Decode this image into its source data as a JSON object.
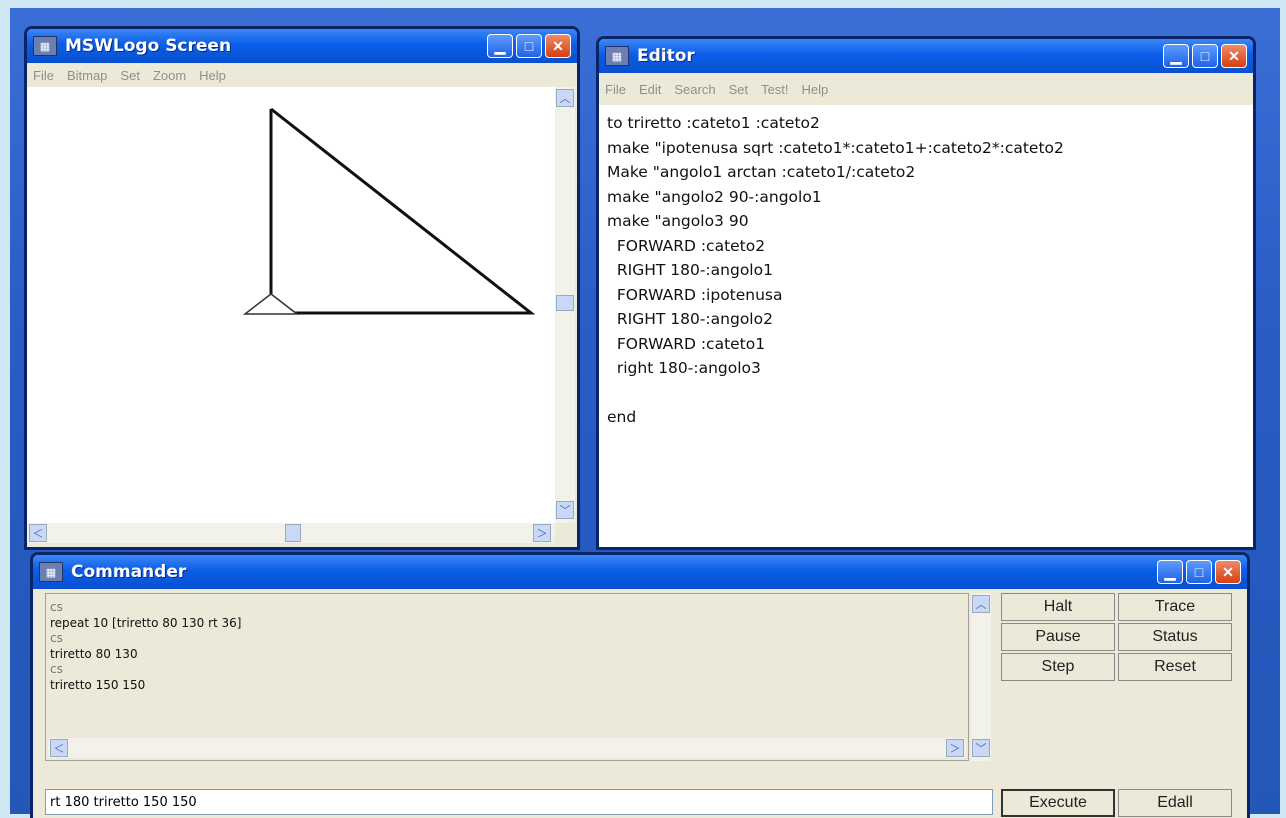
{
  "logo_screen": {
    "title": "MSWLogo Screen",
    "menu": [
      "File",
      "Bitmap",
      "Set",
      "Zoom",
      "Help"
    ]
  },
  "editor": {
    "title": "Editor",
    "menu": [
      "File",
      "Edit",
      "Search",
      "Set",
      "Test!",
      "Help"
    ],
    "code_lines": [
      "to triretto :cateto1 :cateto2",
      "make \"ipotenusa sqrt :cateto1*:cateto1+:cateto2*:cateto2",
      "Make \"angolo1 arctan :cateto1/:cateto2",
      "make \"angolo2 90-:angolo1",
      "make \"angolo3 90",
      "  FORWARD :cateto2",
      "  RIGHT 180-:angolo1",
      "  FORWARD :ipotenusa",
      "  RIGHT 180-:angolo2",
      "  FORWARD :cateto1",
      "  right 180-:angolo3",
      "",
      "end"
    ]
  },
  "commander": {
    "title": "Commander",
    "history": [
      "cs",
      "repeat 10 [triretto 80 130 rt 36]",
      "cs",
      "triretto 80 130",
      "cs",
      "triretto 150 150"
    ],
    "input_value": "rt 180 triretto 150 150",
    "buttons": {
      "halt": "Halt",
      "trace": "Trace",
      "pause": "Pause",
      "status": "Status",
      "step": "Step",
      "reset": "Reset",
      "execute": "Execute",
      "edall": "Edall"
    }
  },
  "colors": {
    "title_bar": "#0a5ee8",
    "close_button": "#d4400f",
    "window_face": "#ece9d8"
  }
}
